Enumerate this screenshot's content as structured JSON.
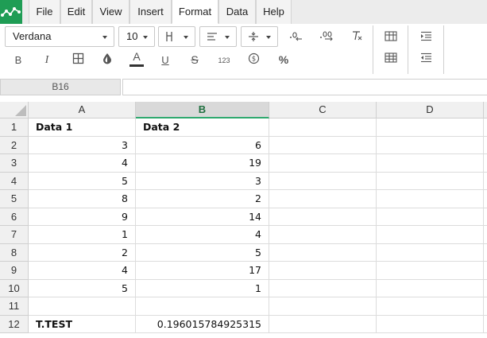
{
  "menu": {
    "items": [
      {
        "label": "File"
      },
      {
        "label": "Edit"
      },
      {
        "label": "View"
      },
      {
        "label": "Insert"
      },
      {
        "label": "Format"
      },
      {
        "label": "Data"
      },
      {
        "label": "Help"
      }
    ],
    "active": "Format"
  },
  "toolbar": {
    "font_family": "Verdana",
    "font_size": "10",
    "number_format_label": "123",
    "percent_label": "%"
  },
  "formula_bar": {
    "cell_reference": "B16",
    "formula_value": ""
  },
  "sheet": {
    "columns": [
      "A",
      "B",
      "C",
      "D"
    ],
    "selected_column": "B",
    "rows": [
      {
        "num": "1",
        "a": "Data 1",
        "b": "Data 2"
      },
      {
        "num": "2",
        "a": "3",
        "b": "6"
      },
      {
        "num": "3",
        "a": "4",
        "b": "19"
      },
      {
        "num": "4",
        "a": "5",
        "b": "3"
      },
      {
        "num": "5",
        "a": "8",
        "b": "2"
      },
      {
        "num": "6",
        "a": "9",
        "b": "14"
      },
      {
        "num": "7",
        "a": "1",
        "b": "4"
      },
      {
        "num": "8",
        "a": "2",
        "b": "5"
      },
      {
        "num": "9",
        "a": "4",
        "b": "17"
      },
      {
        "num": "10",
        "a": "5",
        "b": "1"
      },
      {
        "num": "11",
        "a": "",
        "b": ""
      },
      {
        "num": "12",
        "a": "T.TEST",
        "b": "0.196015784925315"
      }
    ]
  },
  "colors": {
    "logo": "#1f9d55",
    "selected_column_accent": "#2fa96e"
  }
}
